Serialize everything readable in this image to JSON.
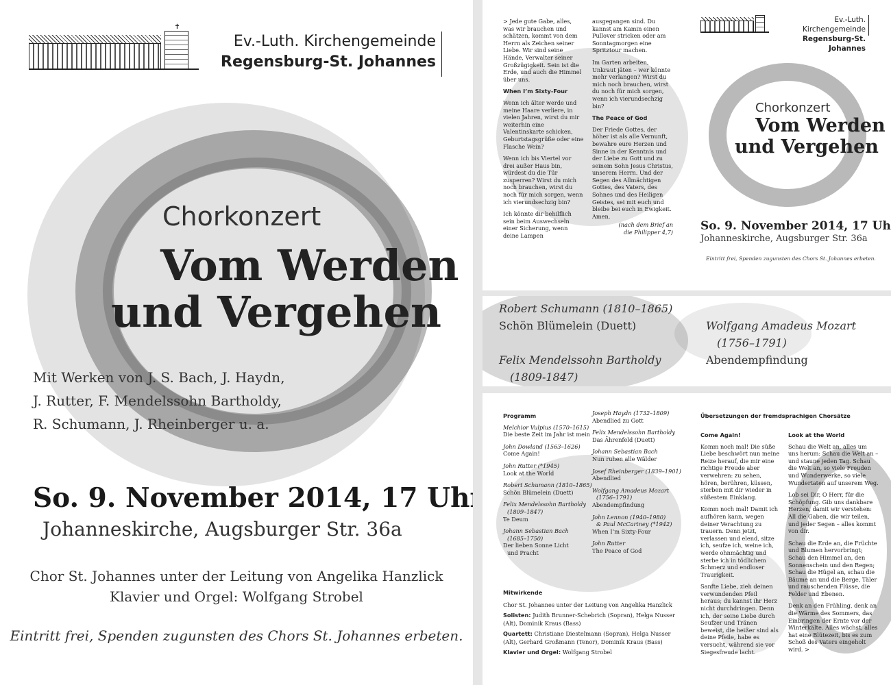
{
  "logo": {
    "line1": "Ev.-Luth. Kirchengemeinde",
    "line2": "Regensburg-St. Johannes",
    "icon": "church-building-icon"
  },
  "poster": {
    "subtitle": "Chorkonzert",
    "title_line1": "Vom Werden",
    "title_line2": "und Vergehen",
    "works": [
      "Mit Werken von J. S. Bach, J. Haydn,",
      "J. Rutter, F. Mendelssohn Bartholdy,",
      "R. Schumann, J. Rheinberger u. a."
    ],
    "date": "So. 9. November 2014, 17 Uhr",
    "place": "Johanneskirche, Augsburger Str. 36a",
    "choir_line1": "Chor St. Johannes unter der Leitung von Angelika Hanzlick",
    "choir_line2": "Klavier und Orgel: Wolfgang Strobel",
    "entry": "Eintritt frei, Spenden zugunsten des Chors St. Johannes erbeten."
  },
  "back": {
    "left_paragraphs": [
      "> Jede gute Gabe, alles, was wir brauchen und schätzen, kommt von dem Herrn als Zeichen seiner Liebe. Wir sind seine Hände, Verwalter seiner Großzügigkeit. Sein ist die Erde, und auch die Himmel über uns."
    ],
    "sixty_four_heading": "When I’m Sixty-Four",
    "sixty_four_paragraphs": [
      "Wenn ich älter werde und meine Haare verliere, in vielen Jahren, wirst du mir weiterhin eine Valentinskarte schicken, Geburtstagsgrüße oder eine Flasche Wein?",
      "Wenn ich bis Viertel vor drei außer Haus bin, würdest du die Tür zusperren? Wirst du mich noch brauchen, wirst du noch für mich sorgen, wenn ich vierundsechzig bin?",
      "Ich könnte dir behilflich sein beim Auswechseln einer Sicherung, wenn deine Lampen"
    ],
    "right_paragraphs": [
      "ausgegangen sind. Du kannst am Kamin einen Pullover stricken oder am Sonntagmorgen eine Spritztour machen.",
      "Im Garten arbeiten, Unkraut jäten – wer könnte mehr verlangen? Wirst du mich noch brauchen, wirst du noch für mich sorgen, wenn ich vierundsechzig bin?"
    ],
    "peace_heading": "The Peace of God",
    "peace_text": "Der Friede Gottes, der höher ist als alle Vernunft, bewahre eure Herzen und Sinne in der Kenntnis und der Liebe zu Gott und zu seinem Sohn Jesus Christus, unserem Herrn. Und der Segen des Allmächtigen Gottes, des Vaters, des Sohnes und des Heiligen Geistes, sei mit euch und bleibe bei euch in Ewigkeit. Amen.",
    "peace_source_1": "(nach dem Brief an",
    "peace_source_2": "die Philipper 4,7)"
  },
  "cover": {
    "subtitle": "Chorkonzert",
    "title_line1": "Vom Werden",
    "title_line2": "und Vergehen",
    "date": "So. 9. November 2014, 17 Uhr",
    "place": "Johanneskirche, Augsburger Str. 36a",
    "entry": "Eintritt frei, Spenden zugunsten des Chors St. Johannes erbeten."
  },
  "strip": {
    "schumann_composer": "Robert Schumann (1810–1865)",
    "schumann_work": "Schön Blümelein (Duett)",
    "mendelssohn_composer_1": "Felix Mendelssohn Bartholdy",
    "mendelssohn_composer_2": "(1809-1847)",
    "mozart_composer_1": "Wolfgang Amadeus Mozart",
    "mozart_composer_2": "(1756–1791)",
    "mozart_work": "Abendempfindung"
  },
  "program": {
    "heading": "Programm",
    "col1": [
      {
        "c": "Melchior Vulpius (1570–1615)",
        "w": "Die beste Zeit im Jahr ist mein"
      },
      {
        "c": "John Dowland (1563–1626)",
        "w": "Come Again!"
      },
      {
        "c": "John Rutter (*1945)",
        "w": "Look at the World"
      },
      {
        "c": "Robert Schumann (1810–1865)",
        "w": "Schön Blümelein (Duett)"
      },
      {
        "c": "Felix Mendelssohn Bartholdy",
        "c2": "(1809–1847)",
        "w": "Te Deum"
      },
      {
        "c": "Johann Sebastian Bach",
        "c2": "(1685–1750)",
        "w": "Der lieben Sonne Licht",
        "w2": "und Pracht"
      }
    ],
    "col2": [
      {
        "c": "Joseph Haydn (1732–1809)",
        "w": "Abendlied zu Gott"
      },
      {
        "c": "Felix Mendelssohn Bartholdy",
        "w": "Das Ährenfeld (Duett)"
      },
      {
        "c": "Johann Sebastian Bach",
        "w": "Nun ruhen alle Wälder"
      },
      {
        "c": "Josef Rheinberger (1839–1901)",
        "w": "Abendlied"
      },
      {
        "c": "Wolfgang Amadeus Mozart",
        "c2": "(1756–1791)",
        "w": "Abendempfindung"
      },
      {
        "c": "John Lennon (1940–1980)",
        "c2": "& Paul McCartney (*1942)",
        "w": "When I’m Sixty-Four"
      },
      {
        "c": "John Rutter",
        "w": "The Peace of God"
      }
    ],
    "performers_heading": "Mitwirkende",
    "performers_choir": "Chor St. Johannes unter der Leitung von Angelika Hanzlick",
    "soloists_label": "Solisten:",
    "soloists": "Judith Brunner-Schebrich (Sopran), Helga Nusser (Alt), Dominik Kraus (Bass)",
    "quartet_label": "Quartett:",
    "quartet": "Christiane Diestelmann (Sopran), Helga Nusser (Alt), Gerhard Großmann (Tenor), Dominik Kraus (Bass)",
    "piano_label": "Klavier und Orgel:",
    "piano": "Wolfgang Strobel"
  },
  "translations": {
    "heading": "Übersetzungen der fremdsprachigen Chorsätze",
    "come_again_heading": "Come Again!",
    "come_again_paragraphs": [
      "Komm noch mal! Die süße Liebe beschwört nun meine Reize herauf, die mir eine richtige Freude aber verwehren: zu sehen, hören, berühren, küssen, sterben mit dir wieder in süßestem Einklang.",
      "Komm noch mal! Damit ich aufhören kann, wegen deiner Verachtung zu trauern. Denn jetzt, verlassen und elend, sitze ich, seufze ich, weine ich, werde ohnmächtig und sterbe ich in tödlichem Schmerz und endloser Traurigkeit.",
      "Sanfte Liebe, zieh deinen verwundenden Pfeil heraus; du kannst ihr Herz nicht durchdringen. Denn ich, der seine Liebe durch Seufzer und Tränen beweist, die heißer sind als deine Pfeile, habe es versucht, während sie vor Siegesfreude lacht."
    ],
    "look_heading": "Look at the World",
    "look_paragraphs": [
      "Schau die Welt an, alles um uns herum: Schau die Welt an – und staune jeden Tag. Schau die Welt an, so viele Freuden und Wunderwerke, so viele Wundertaten auf unserem Weg.",
      "Lob sei Dir, O Herr, für die Schöpfung. Gib uns dankbare Herzen, damit wir verstehen: All die Gaben, die wir teilen, und jeder Segen – alles kommt von dir.",
      "Schau die Erde an, die Früchte und Blumen hervorbringt; Schau den Himmel an, den Sonnenschein und den Regen; Schau die Hügel an, schau die Bäume an und die Berge, Täler und rauschenden Flüsse, die Felder und Ebenen.",
      "Denk an den Frühling, denk an die Wärme des Sommers, das Einbringen der Ernte vor der Winterkälte. Alles wächst, alles hat eine Blütezeit, bis es zum Schoß des Vaters eingeholt wird. >"
    ]
  }
}
